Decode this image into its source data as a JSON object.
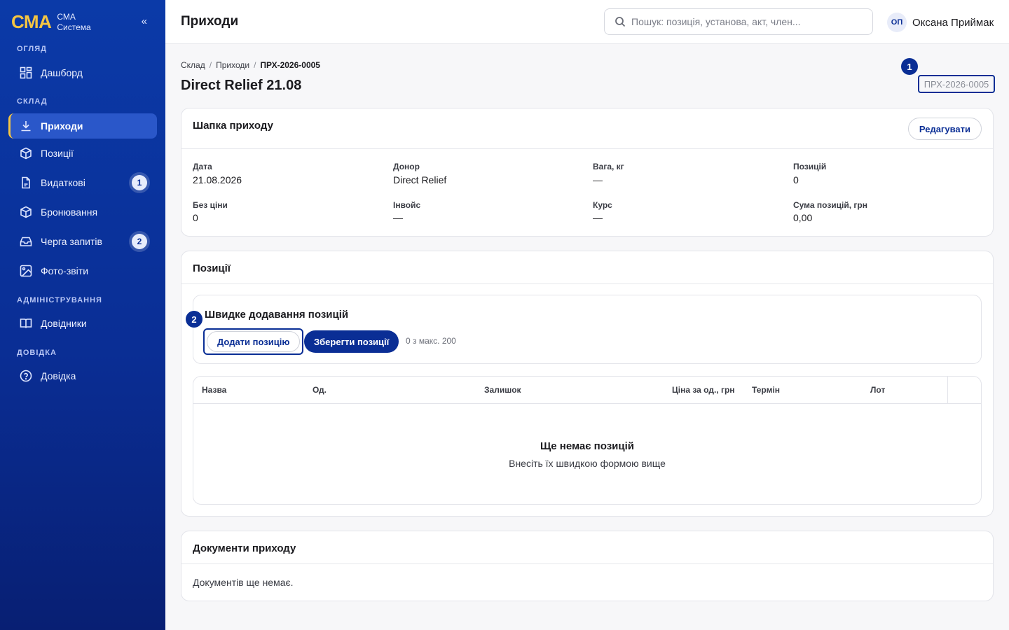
{
  "app": {
    "logo": "СМА",
    "subtitle_line1": "СМА",
    "subtitle_line2": "Система",
    "collapse_symbol": "«"
  },
  "sidebar": {
    "sections": [
      {
        "label": "ОГЛЯД"
      },
      {
        "label": "СКЛАД"
      },
      {
        "label": "АДМІНІСТРУВАННЯ"
      },
      {
        "label": "ДОВІДКА"
      }
    ],
    "items": [
      {
        "label": "Дашборд",
        "icon": "dashboard-icon"
      },
      {
        "label": "Приходи",
        "icon": "download-icon",
        "active": true
      },
      {
        "label": "Позиції",
        "icon": "box-icon"
      },
      {
        "label": "Видаткові",
        "icon": "document-icon",
        "badge": "1"
      },
      {
        "label": "Бронювання",
        "icon": "box-icon"
      },
      {
        "label": "Черга запитів",
        "icon": "inbox-icon",
        "badge": "2"
      },
      {
        "label": "Фото-звіти",
        "icon": "image-icon"
      },
      {
        "label": "Довідники",
        "icon": "book-icon"
      },
      {
        "label": "Довідка",
        "icon": "help-icon"
      }
    ]
  },
  "header": {
    "title": "Приходи",
    "search_placeholder": "Пошук: позиція, установа, акт, член...",
    "user_initials": "ОП",
    "user_name": "Оксана Приймак"
  },
  "breadcrumb": {
    "items": [
      "Склад",
      "Приходи"
    ],
    "separator": "/",
    "current": "ПРХ-2026-0005"
  },
  "document": {
    "title": "Direct Relief 21.08",
    "id_chip": "ПРХ-2026-0005",
    "markers": [
      "1",
      "2"
    ]
  },
  "header_card": {
    "title": "Шапка приходу",
    "edit_label": "Редагувати",
    "fields": [
      {
        "label": "Дата",
        "value": "21.08.2026"
      },
      {
        "label": "Донор",
        "value": "Direct Relief"
      },
      {
        "label": "Вага, кг",
        "value": "—"
      },
      {
        "label": "Позицій",
        "value": "0"
      },
      {
        "label": "Без ціни",
        "value": "0"
      },
      {
        "label": "Інвойс",
        "value": "—"
      },
      {
        "label": "Курс",
        "value": "—"
      },
      {
        "label": "Сума позицій, грн",
        "value": "0,00"
      }
    ]
  },
  "positions_card": {
    "title": "Позиції",
    "quick_title": "Швидке додавання позицій",
    "add_label": "Додати позицію",
    "save_label": "Зберегти позиції",
    "counter": "0 з макс. 200",
    "columns": [
      "Назва",
      "Од.",
      "Залишок",
      "Ціна за од., грн",
      "Термін",
      "Лот"
    ],
    "empty_title": "Ще немає позицій",
    "empty_subtitle": "Внесіть їх швидкою формою вище"
  },
  "documents_card": {
    "title": "Документи приходу",
    "empty_text": "Документів ще немає."
  },
  "colors": {
    "sidebar": "#0a2e95",
    "accent": "#0a2e95",
    "brand_yellow": "#f5c542"
  }
}
